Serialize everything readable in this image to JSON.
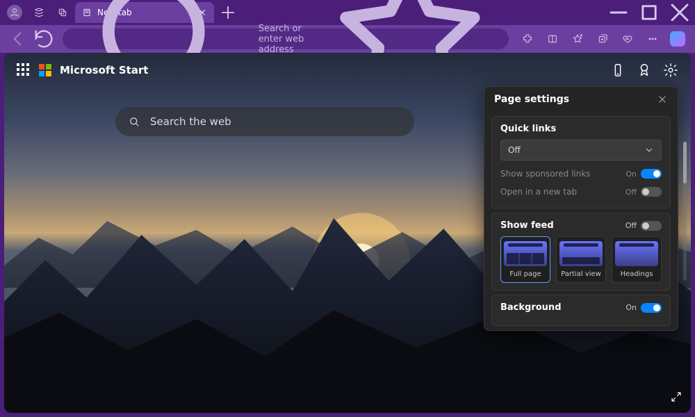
{
  "titlebar": {
    "tab_label": "New tab"
  },
  "addressbar": {
    "placeholder": "Search or enter web address"
  },
  "ntp": {
    "brand": "Microsoft Start",
    "search_placeholder": "Search the web"
  },
  "settings": {
    "title": "Page settings",
    "quick_links": {
      "heading": "Quick links",
      "dropdown_value": "Off",
      "sponsored": {
        "label": "Show sponsored links",
        "state": "On"
      },
      "new_tab": {
        "label": "Open in a new tab",
        "state": "Off"
      }
    },
    "feed": {
      "heading": "Show feed",
      "state": "Off",
      "tiles": [
        "Full page",
        "Partial view",
        "Headings"
      ]
    },
    "background": {
      "heading": "Background",
      "state": "On"
    }
  }
}
